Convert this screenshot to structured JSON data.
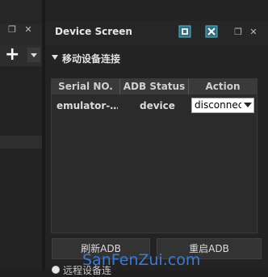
{
  "colors": {
    "background": "#1f1f1f",
    "panel": "#232323",
    "table_header": "#3a3a3a",
    "watermark": "#3b7bd6",
    "accent_icon": "#2aa5b8"
  },
  "left_panel": {
    "window_icons": [
      "restore-icon",
      "close-icon"
    ],
    "restore_glyph": "❐",
    "close_glyph": "✕",
    "plus_glyph": "+"
  },
  "device_screen": {
    "title": "Device Screen",
    "header_icons": [
      "screen-icon",
      "tools-icon",
      "restore-icon",
      "close-icon"
    ],
    "restore_glyph": "❐",
    "close_glyph": "✕",
    "section_label": "移动设备连接",
    "table": {
      "columns": [
        "Serial NO.",
        "ADB Status",
        "Action"
      ],
      "rows": [
        {
          "serial": "emulator-…",
          "status": "device",
          "action": "disconnec"
        }
      ]
    },
    "buttons": {
      "refresh": "刷新ADB",
      "restart": "重启ADB"
    },
    "partial_option": "远程设备连"
  },
  "watermark": "SanFenZui.com"
}
